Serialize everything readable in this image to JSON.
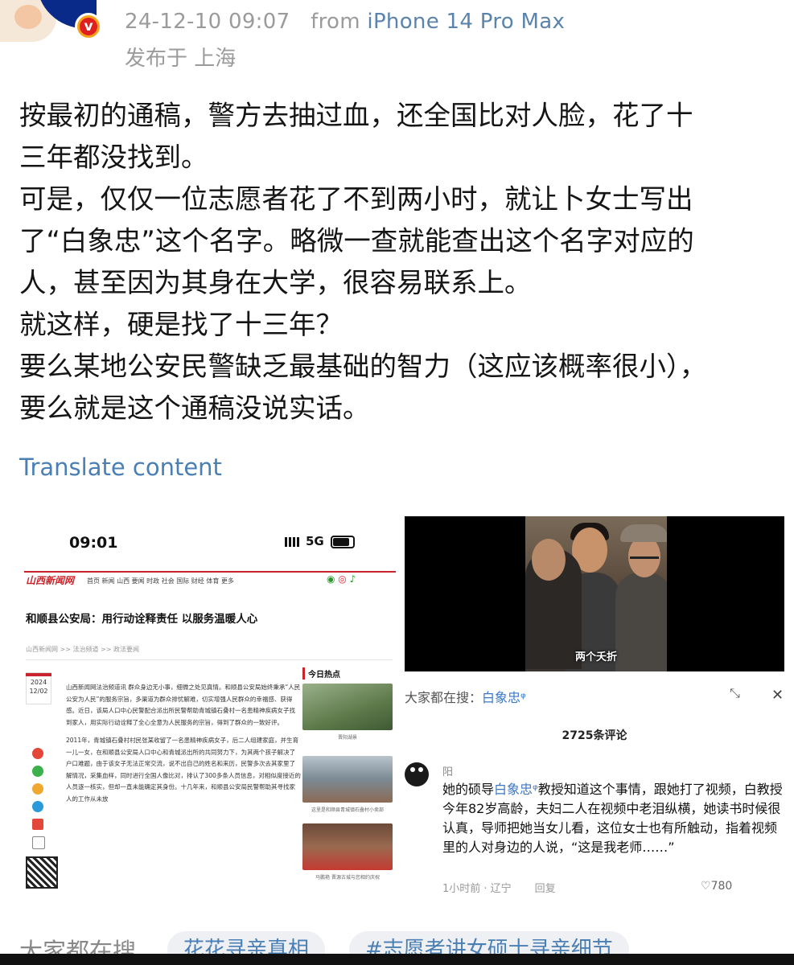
{
  "post_header": {
    "time": "24-12-10 09:07",
    "from_label": "from",
    "device": "iPhone 14 Pro Max",
    "location": "发布于 上海",
    "badge": "v"
  },
  "post_body": {
    "lines": [
      "按最初的通稿，警方去抽过血，还全国比对人脸，花了十",
      "三年都没找到。",
      "可是，仅仅一位志愿者花了不到两小时，就让卜女士写出",
      "了“白象忠”这个名字。略微一查就能查出这个名字对应的",
      "人，甚至因为其身在大学，很容易联系上。",
      "就这样，硬是找了十三年？",
      "要么某地公安民警缺乏最基础的智力（这应该概率很小），",
      "要么就是这个通稿没说实话。"
    ],
    "translate_link": "Translate content"
  },
  "screenshot_left": {
    "status_time": "09:01",
    "network": "5G",
    "site_nav": "首页  新闻  山西  要闻  时政  社会  国际  财经  体育  更多",
    "site_logo": "山西新闻网",
    "article_title": "和顺县公安局：用行动诠释责任 以服务温暖人心",
    "breadcrumb": "山西新闻网 >> 法治频道 >> 政法要闻",
    "date_year": "2024",
    "date_day": "12/02",
    "paragraphs": [
      "山西新闻网法治频道讯 群众身边无小事，细微之处见真情。和顺县公安局始终秉承“人民公安为人民”的服务宗旨，多渠道为群众排忧解难，切实增强人民群众的幸福感、获得感。近日，该局人口中心民警配合派出所民警帮助青城镇石叠村一名患精神疾病女子找到家人，用实际行动诠释了全心全意为人民服务的宗旨，得到了群众的一致好评。",
      "2011年，青城镇石叠村村民张某收留了一名患精神疾病女子，后二人组建家庭，并生育一儿一女，在和顺县公安局人口中心和青城派出所的共同努力下，为其两个孩子解决了户口难题，由于该女子无法正常交流，说不出自己的姓名和来历，民警多次去其家里了解情况，采集血样，同时进行全国人像比对，排认了300多条人员信息，对相似度接近的人员逐一核实，但却一直未能确定其身份。十几年来，和顺县公安局民警帮助其寻找家人的工作从未放"
    ],
    "sidebar_heading": "今日热点",
    "thumb_captions": [
      "晋阳湖景",
      "这里是和顺县青城镇石叠村小卖部",
      "马鹏艳 晋源古城与您相约庆祝"
    ]
  },
  "screenshot_right": {
    "video_caption": "两个夭折",
    "search_prefix": "大家都在搜：",
    "search_keyword": "白象忠",
    "comment_count": "2725条评论",
    "commenter": "阳",
    "comment_pre": "她的硕导",
    "comment_keyword": "白象忠",
    "comment_post": "教授知道这个事情，跟她打了视频，白教授今年82岁高龄，夫妇二人在视频中老泪纵横，她读书时候很认真，导师把她当女儿看，这位女士也有所触动，指着视频里的人对身边的人说，“这是我老师……”",
    "comment_time": "1小时前 · 辽宁",
    "reply": "回复",
    "likes": "780"
  },
  "bottom": {
    "label": "大家都在搜",
    "tags": [
      "花花寻亲真相",
      "#志愿者讲女硕士寻亲细节"
    ]
  }
}
